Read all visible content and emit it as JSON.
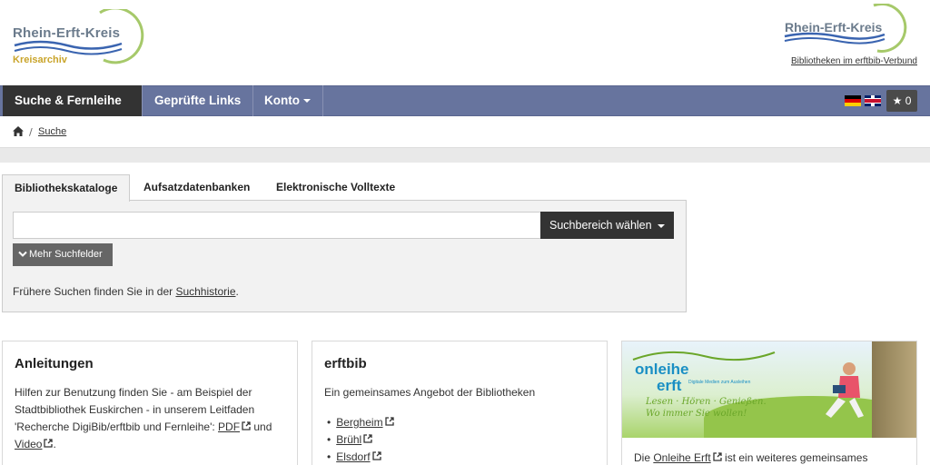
{
  "header": {
    "left_logo_name": "Rhein-Erft-Kreis",
    "left_logo_sub": "Kreisarchiv",
    "right_logo_name": "Rhein-Erft-Kreis",
    "verbund_link": "Bibliotheken im erftbib-Verbund"
  },
  "nav": {
    "items": [
      {
        "label": "Suche & Fernleihe",
        "active": true,
        "dropdown": true
      },
      {
        "label": "Geprüfte Links",
        "active": false,
        "dropdown": false
      },
      {
        "label": "Konto",
        "active": false,
        "dropdown": true
      }
    ],
    "bookmark_count": "0",
    "colors": {
      "navbar": "#67749e",
      "active": "#333333"
    }
  },
  "breadcrumb": {
    "separator": "/",
    "current": "Suche"
  },
  "search": {
    "tabs": [
      "Bibliothekskataloge",
      "Aufsatzdatenbanken",
      "Elektronische Volltexte"
    ],
    "input_value": "",
    "scope_button": "Suchbereich wählen",
    "more_fields": "Mehr Suchfelder",
    "history_prefix": "Frühere Suchen finden Sie in der ",
    "history_link": "Suchhistorie",
    "history_suffix": "."
  },
  "cards": {
    "anleitungen": {
      "title": "Anleitungen",
      "text_l1": "Hilfen zur Benutzung finden Sie - am Beispiel der",
      "text_l2": "Stadtbibliothek Euskirchen - in unserem Leitfaden",
      "text_l3": "'Recherche DigiBib/erftbib und Fernleihe': ",
      "pdf_link": "PDF",
      "and": " und",
      "video_link": "Video",
      "end": "."
    },
    "erftbib": {
      "title": "erftbib",
      "text": "Ein gemeinsames Angebot der Bibliotheken",
      "libraries": [
        "Bergheim",
        "Brühl",
        "Elsdorf"
      ]
    },
    "onleihe": {
      "logo_line1": "onleihe",
      "logo_line2": "erft",
      "logo_small": "Digitale Medien zum Ausleihen",
      "tagline_l1": "Lesen · Hören · Genießen.",
      "tagline_l2": "Wo immer Sie wollen!",
      "text_prefix": "Die ",
      "link": "Onleihe Erft",
      "text_suffix": " ist ein weiteres gemeinsames"
    }
  }
}
